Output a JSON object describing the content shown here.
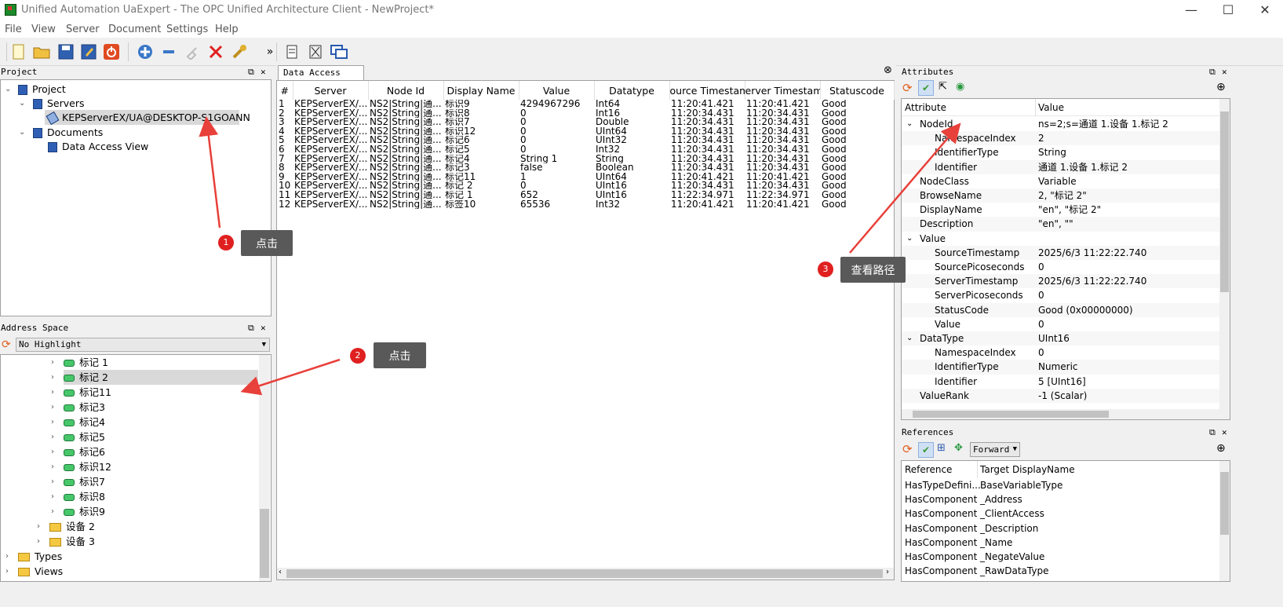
{
  "window": {
    "title": "Unified Automation UaExpert - The OPC Unified Architecture Client - NewProject*"
  },
  "menu": [
    "File",
    "View",
    "Server",
    "Document",
    "Settings",
    "Help"
  ],
  "project_panel": {
    "title": "Project",
    "root": "Project",
    "servers": "Servers",
    "server_item": "KEPServerEX/UA@DESKTOP-S1GOANN",
    "documents": "Documents",
    "document_item": "Data Access View"
  },
  "address_panel": {
    "title": "Address Space",
    "highlight": "No Highlight",
    "items": [
      "标记 1",
      "标记 2",
      "标记11",
      "标记3",
      "标记4",
      "标记5",
      "标记6",
      "标识12",
      "标识7",
      "标识8",
      "标识9"
    ],
    "folders": [
      "设备 2",
      "设备 3"
    ],
    "root_items": [
      "Types",
      "Views"
    ]
  },
  "da_view": {
    "tab": "Data Access View",
    "columns": [
      "#",
      "Server",
      "Node Id",
      "Display Name",
      "Value",
      "Datatype",
      "ource Timestam",
      "erver Timestam",
      "Statuscode"
    ],
    "rows": [
      [
        "1",
        "KEPServerEX/...",
        "NS2|String|通...",
        "标识9",
        "4294967296",
        "Int64",
        "11:20:41.421",
        "11:20:41.421",
        "Good"
      ],
      [
        "2",
        "KEPServerEX/...",
        "NS2|String|通...",
        "标识8",
        "0",
        "Int16",
        "11:20:34.431",
        "11:20:34.431",
        "Good"
      ],
      [
        "3",
        "KEPServerEX/...",
        "NS2|String|通...",
        "标识7",
        "0",
        "Double",
        "11:20:34.431",
        "11:20:34.431",
        "Good"
      ],
      [
        "4",
        "KEPServerEX/...",
        "NS2|String|通...",
        "标识12",
        "0",
        "UInt64",
        "11:20:34.431",
        "11:20:34.431",
        "Good"
      ],
      [
        "5",
        "KEPServerEX/...",
        "NS2|String|通...",
        "标记6",
        "0",
        "UInt32",
        "11:20:34.431",
        "11:20:34.431",
        "Good"
      ],
      [
        "6",
        "KEPServerEX/...",
        "NS2|String|通...",
        "标记5",
        "0",
        "Int32",
        "11:20:34.431",
        "11:20:34.431",
        "Good"
      ],
      [
        "7",
        "KEPServerEX/...",
        "NS2|String|通...",
        "标记4",
        "String 1",
        "String",
        "11:20:34.431",
        "11:20:34.431",
        "Good"
      ],
      [
        "8",
        "KEPServerEX/...",
        "NS2|String|通...",
        "标记3",
        "false",
        "Boolean",
        "11:20:34.431",
        "11:20:34.431",
        "Good"
      ],
      [
        "9",
        "KEPServerEX/...",
        "NS2|String|通...",
        "标记11",
        "1",
        "UInt64",
        "11:20:41.421",
        "11:20:41.421",
        "Good"
      ],
      [
        "10",
        "KEPServerEX/...",
        "NS2|String|通...",
        "标记 2",
        "0",
        "UInt16",
        "11:20:34.431",
        "11:20:34.431",
        "Good"
      ],
      [
        "11",
        "KEPServerEX/...",
        "NS2|String|通...",
        "标记 1",
        "652",
        "UInt16",
        "11:22:34.971",
        "11:22:34.971",
        "Good"
      ],
      [
        "12",
        "KEPServerEX/...",
        "NS2|String|通...",
        "标签10",
        "65536",
        "Int32",
        "11:20:41.421",
        "11:20:41.421",
        "Good"
      ]
    ]
  },
  "attributes": {
    "title": "Attributes",
    "col_attr": "Attribute",
    "col_value": "Value",
    "rows": [
      {
        "name": "NodeId",
        "value": "ns=2;s=通道 1.设备 1.标记 2",
        "level": 0,
        "chev": "v"
      },
      {
        "name": "NamespaceIndex",
        "value": "2",
        "level": 1
      },
      {
        "name": "IdentifierType",
        "value": "String",
        "level": 1
      },
      {
        "name": "Identifier",
        "value": "通道 1.设备 1.标记 2",
        "level": 1
      },
      {
        "name": "NodeClass",
        "value": "Variable",
        "level": 0
      },
      {
        "name": "BrowseName",
        "value": "2, \"标记 2\"",
        "level": 0
      },
      {
        "name": "DisplayName",
        "value": "\"en\", \"标记 2\"",
        "level": 0
      },
      {
        "name": "Description",
        "value": "\"en\", \"\"",
        "level": 0
      },
      {
        "name": "Value",
        "value": "",
        "level": 0,
        "chev": "v"
      },
      {
        "name": "SourceTimestamp",
        "value": "2025/6/3 11:22:22.740",
        "level": 1
      },
      {
        "name": "SourcePicoseconds",
        "value": "0",
        "level": 1
      },
      {
        "name": "ServerTimestamp",
        "value": "2025/6/3 11:22:22.740",
        "level": 1
      },
      {
        "name": "ServerPicoseconds",
        "value": "0",
        "level": 1
      },
      {
        "name": "StatusCode",
        "value": "Good (0x00000000)",
        "level": 1
      },
      {
        "name": "Value",
        "value": "0",
        "level": 1
      },
      {
        "name": "DataType",
        "value": "UInt16",
        "level": 0,
        "chev": "v"
      },
      {
        "name": "NamespaceIndex",
        "value": "0",
        "level": 1
      },
      {
        "name": "IdentifierType",
        "value": "Numeric",
        "level": 1
      },
      {
        "name": "Identifier",
        "value": "5 [UInt16]",
        "level": 1
      },
      {
        "name": "ValueRank",
        "value": "-1 (Scalar)",
        "level": 0
      }
    ]
  },
  "references": {
    "title": "References",
    "direction": "Forward",
    "col_ref": "Reference",
    "col_target": "Target DisplayName",
    "rows": [
      [
        "HasTypeDefini...",
        "BaseVariableType"
      ],
      [
        "HasComponent",
        "_Address"
      ],
      [
        "HasComponent",
        "_ClientAccess"
      ],
      [
        "HasComponent",
        "_Description"
      ],
      [
        "HasComponent",
        "_Name"
      ],
      [
        "HasComponent",
        "_NegateValue"
      ],
      [
        "HasComponent",
        "_RawDataType"
      ]
    ]
  },
  "annotations": [
    {
      "num": "1",
      "text": "点击"
    },
    {
      "num": "2",
      "text": "点击"
    },
    {
      "num": "3",
      "text": "查看路径"
    }
  ],
  "colors": {
    "arrow": "#e8403a",
    "callout": "#595959",
    "selected": "#d9d9d9"
  }
}
